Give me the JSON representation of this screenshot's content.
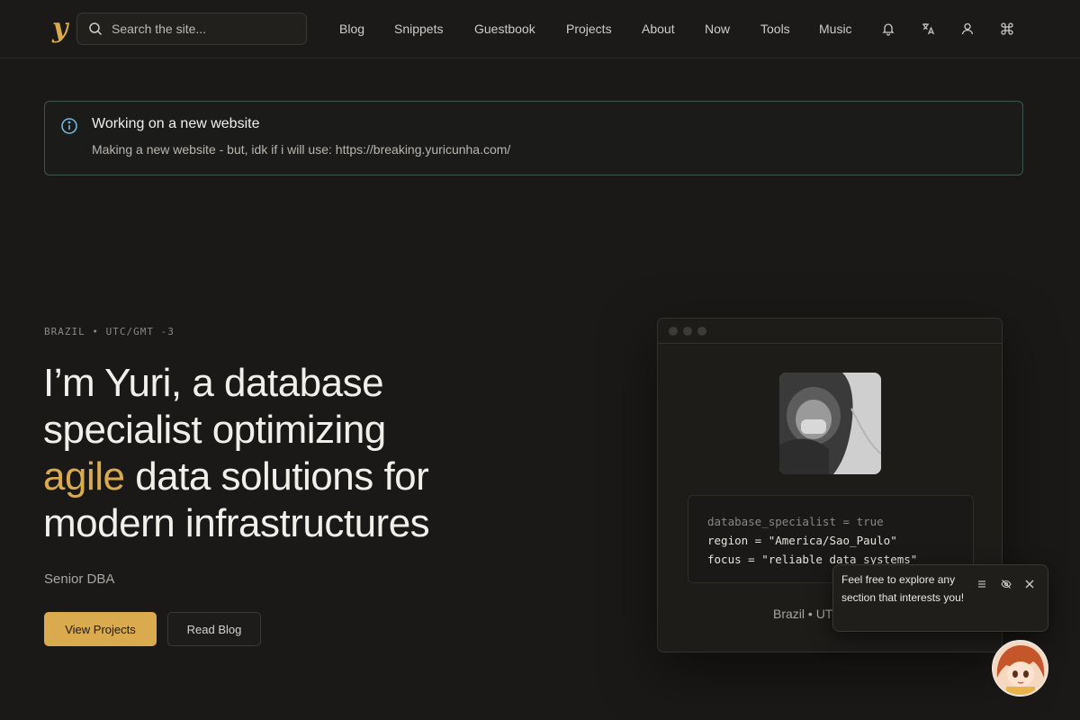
{
  "header": {
    "logo": "y",
    "search_placeholder": "Search the site...",
    "nav": [
      "Blog",
      "Snippets",
      "Guestbook",
      "Projects",
      "About",
      "Now",
      "Tools",
      "Music"
    ],
    "icons": [
      "bell-icon",
      "translate-icon",
      "user-icon",
      "command-icon"
    ]
  },
  "notice": {
    "title": "Working on a new website",
    "body": "Making a new website - but, idk if i will use: https://breaking.yuricunha.com/"
  },
  "hero": {
    "eyebrow": "BRAZIL • UTC/GMT -3",
    "line1": "I’m Yuri, a database",
    "line2": "specialist optimizing",
    "accent": "agile",
    "line3_rest": " data solutions for",
    "line4": "modern infrastructures",
    "role": "Senior DBA",
    "primary_button": "View Projects",
    "secondary_button": "Read Blog"
  },
  "card": {
    "code": [
      "database_specialist = true",
      "region = \"America/Sao_Paulo\"",
      "focus = \"reliable data systems\""
    ],
    "location": "Brazil • UTC"
  },
  "chat": {
    "message": "Feel free to explore any section that interests you!"
  },
  "colors": {
    "background": "#1a1917",
    "accent": "#d9ab4e",
    "notice_border": "#3e5651"
  }
}
